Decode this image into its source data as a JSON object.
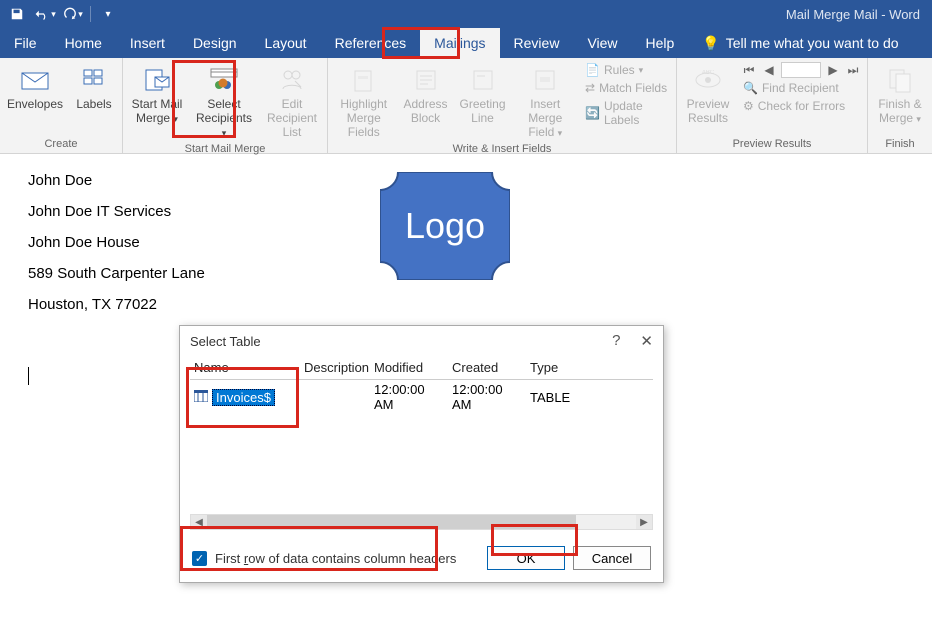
{
  "app_title": "Mail Merge Mail  -  Word",
  "qat": {
    "save": "save",
    "undo": "undo",
    "redo": "redo"
  },
  "tabs": {
    "file": "File",
    "home": "Home",
    "insert": "Insert",
    "design": "Design",
    "layout": "Layout",
    "references": "References",
    "mailings": "Mailings",
    "review": "Review",
    "view": "View",
    "help": "Help",
    "tellme": "Tell me what you want to do"
  },
  "ribbon": {
    "create": {
      "envelopes": "Envelopes",
      "labels": "Labels",
      "group": "Create"
    },
    "startmm": {
      "start": "Start Mail Merge",
      "select": "Select Recipients",
      "edit": "Edit Recipient List",
      "group": "Start Mail Merge"
    },
    "write": {
      "highlight": "Highlight Merge Fields",
      "address": "Address Block",
      "greeting": "Greeting Line",
      "insertfield": "Insert Merge Field",
      "rules": "Rules",
      "match": "Match Fields",
      "update": "Update Labels",
      "group": "Write & Insert Fields"
    },
    "preview": {
      "preview": "Preview Results",
      "find": "Find Recipient",
      "check": "Check for Errors",
      "group": "Preview Results"
    },
    "finish": {
      "finish": "Finish & Merge",
      "group": "Finish"
    }
  },
  "document": {
    "l1": "John Doe",
    "l2": "John Doe IT Services",
    "l3": "John Doe House",
    "l4": "589 South Carpenter Lane",
    "l5": "Houston, TX 77022",
    "logo": "Logo"
  },
  "dialog": {
    "title": "Select Table",
    "cols": {
      "name": "Name",
      "desc": "Description",
      "mod": "Modified",
      "created": "Created",
      "type": "Type"
    },
    "row": {
      "name": "Invoices$",
      "mod": "12:00:00 AM",
      "created": "12:00:00 AM",
      "type": "TABLE"
    },
    "checkbox": {
      "pre": "First ",
      "ul": "r",
      "post": "ow of data contains column headers"
    },
    "ok": "OK",
    "cancel": "Cancel"
  }
}
